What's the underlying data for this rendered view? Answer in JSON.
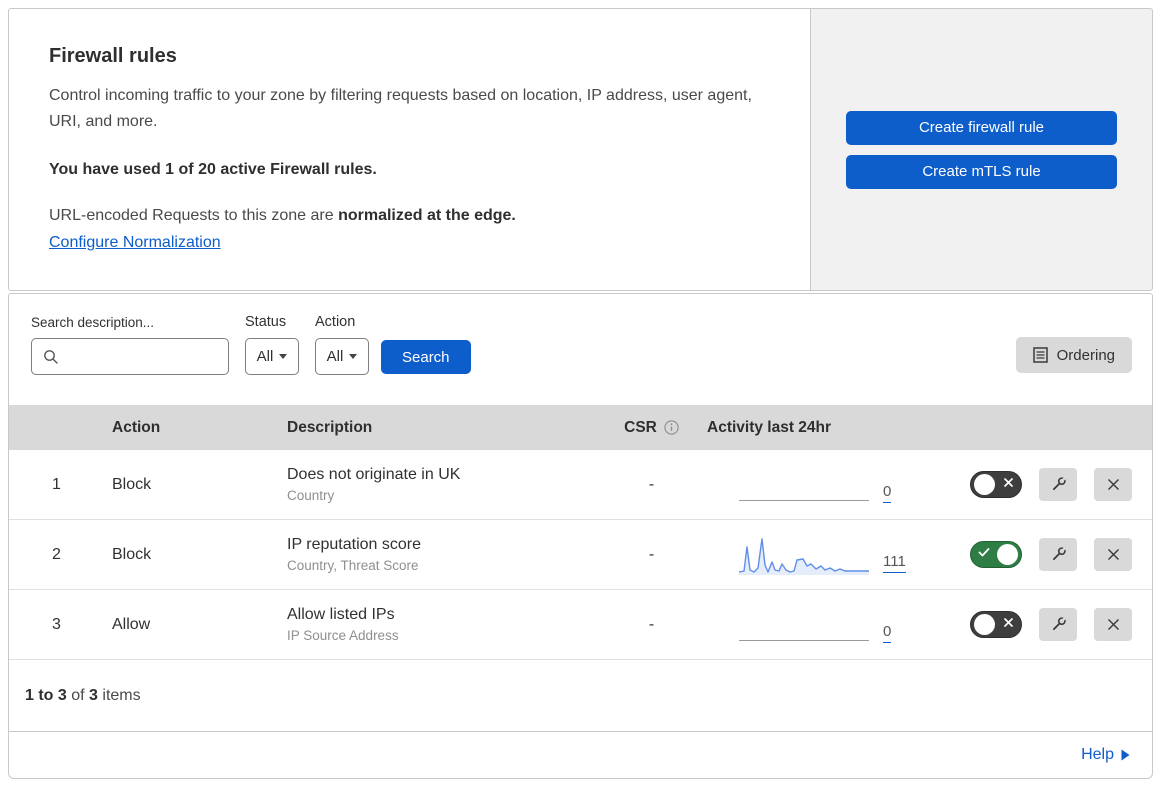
{
  "header": {
    "title": "Firewall rules",
    "description": "Control incoming traffic to your zone by filtering requests based on location, IP address, user agent, URI, and more.",
    "usage_notice": "You have used 1 of 20 active Firewall rules.",
    "normalization_prefix": "URL-encoded Requests to this zone are ",
    "normalization_bold": "normalized at the edge.",
    "normalization_link": "Configure Normalization",
    "create_firewall_rule_label": "Create firewall rule",
    "create_mtls_rule_label": "Create mTLS rule"
  },
  "filters": {
    "search_label": "Search description...",
    "search_value": "",
    "status_label": "Status",
    "status_value": "All",
    "action_label": "Action",
    "action_value": "All",
    "search_button_label": "Search",
    "ordering_button_label": "Ordering"
  },
  "table": {
    "columns": {
      "action": "Action",
      "description": "Description",
      "csr": "CSR",
      "activity": "Activity last 24hr"
    },
    "rows": [
      {
        "priority": "1",
        "action": "Block",
        "description": "Does not originate in UK",
        "fields": "Country",
        "csr": "-",
        "activity_count": "0",
        "enabled": false,
        "sparkline": null
      },
      {
        "priority": "2",
        "action": "Block",
        "description": "IP reputation score",
        "fields": "Country, Threat Score",
        "csr": "-",
        "activity_count": "111",
        "enabled": true,
        "sparkline": [
          [
            0,
            37
          ],
          [
            5,
            36
          ],
          [
            8,
            12
          ],
          [
            11,
            35
          ],
          [
            15,
            37
          ],
          [
            19,
            33
          ],
          [
            23,
            4
          ],
          [
            26,
            30
          ],
          [
            29,
            37
          ],
          [
            33,
            27
          ],
          [
            36,
            35
          ],
          [
            40,
            36
          ],
          [
            43,
            29
          ],
          [
            47,
            35
          ],
          [
            51,
            37
          ],
          [
            55,
            36
          ],
          [
            58,
            25
          ],
          [
            64,
            24
          ],
          [
            68,
            31
          ],
          [
            72,
            29
          ],
          [
            77,
            34
          ],
          [
            82,
            31
          ],
          [
            86,
            35
          ],
          [
            91,
            33
          ],
          [
            96,
            36
          ],
          [
            101,
            34
          ],
          [
            106,
            36
          ],
          [
            111,
            36
          ],
          [
            116,
            36
          ],
          [
            121,
            36
          ],
          [
            126,
            36
          ],
          [
            130,
            36
          ]
        ]
      },
      {
        "priority": "3",
        "action": "Allow",
        "description": "Allow listed IPs",
        "fields": "IP Source Address",
        "csr": "-",
        "activity_count": "0",
        "enabled": false,
        "sparkline": null
      }
    ]
  },
  "footer": {
    "range_bold": "1 to 3",
    "of_text": "of",
    "total_bold": "3",
    "items_text": "items",
    "help_label": "Help"
  },
  "icons": {
    "search_icon": "magnifier",
    "dropdown_caret_icon": "triangle-down",
    "ordering_icon": "list-page",
    "info_icon": "circled-i",
    "toggle_off_icon": "x-mark",
    "toggle_on_icon": "check-mark",
    "wrench_icon": "wrench",
    "delete_icon": "x-mark",
    "help_arrow_icon": "triangle-right"
  },
  "colors": {
    "primary_blue": "#0d5dcb",
    "toggle_on_green": "#2e7d44",
    "toggle_off_dark": "#3e3e3e",
    "sparkline_blue": "#5f8ee8",
    "panel_gray": "#f1f1f1",
    "control_gray": "#d9d9d9"
  }
}
